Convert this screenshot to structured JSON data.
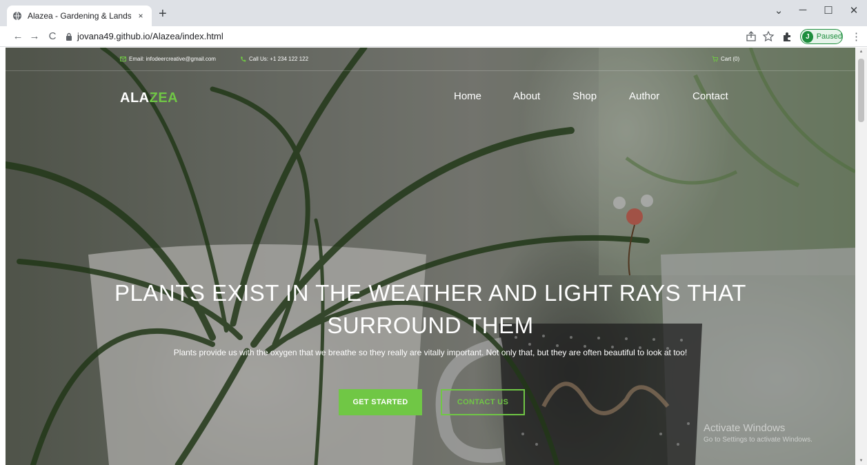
{
  "browser": {
    "tab_title": "Alazea - Gardening & Landscapi",
    "tab_close": "×",
    "new_tab": "+",
    "url": "jovana49.github.io/Alazea/index.html",
    "profile_initial": "J",
    "profile_status": "Paused",
    "window_controls": {
      "minimize": "─",
      "maximize": "☐",
      "close": "✕",
      "chevron": "⌄"
    },
    "nav": {
      "back": "←",
      "forward": "→",
      "reload": "C"
    },
    "menu": "⋮"
  },
  "topbar": {
    "email": "Email: infodeercreative@gmail.com",
    "phone": "Call Us: +1 234 122 122",
    "cart": "Cart (0)"
  },
  "header": {
    "logo_part1": "ALA",
    "logo_part2": "ZEA",
    "nav": [
      "Home",
      "About",
      "Shop",
      "Author",
      "Contact"
    ]
  },
  "hero": {
    "title_line1": "PLANTS EXIST IN THE WEATHER AND LIGHT RAYS THAT",
    "title_line2": "SURROUND THEM",
    "subtitle": "Plants provide us with the oxygen that we breathe so they really are vitally important. Not only that, but they are often beautiful to look at too!",
    "primary_button": "GET STARTED",
    "secondary_button": "CONTACT US"
  },
  "watermark": {
    "title": "Activate Windows",
    "subtitle": "Go to Settings to activate Windows."
  },
  "colors": {
    "accent": "#70c745",
    "chrome_bg": "#dee1e6",
    "profile_green": "#1e8e3e"
  }
}
